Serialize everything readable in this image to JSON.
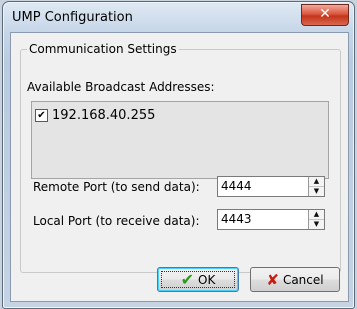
{
  "window": {
    "title": "UMP Configuration",
    "close_icon": "close-x-icon",
    "close_glyph": "✕"
  },
  "group": {
    "title": "Communication Settings",
    "available_label": "Available Broadcast Addresses:",
    "addresses": [
      {
        "address": "192.168.40.255",
        "checked": true,
        "check_glyph": "✔"
      }
    ]
  },
  "ports": {
    "remote_label": "Remote Port (to send data):",
    "remote_value": "4444",
    "local_label": "Local Port (to receive data):",
    "local_value": "4443",
    "up_glyph": "▲",
    "down_glyph": "▼"
  },
  "buttons": {
    "ok_label": "OK",
    "ok_icon": "checkmark-icon",
    "ok_glyph": "✔",
    "cancel_label": "Cancel",
    "cancel_icon": "x-icon",
    "cancel_glyph": "✘"
  },
  "colors": {
    "close_red": "#c3341a",
    "ok_green": "#2c9a1a",
    "cancel_red": "#c81a10"
  }
}
